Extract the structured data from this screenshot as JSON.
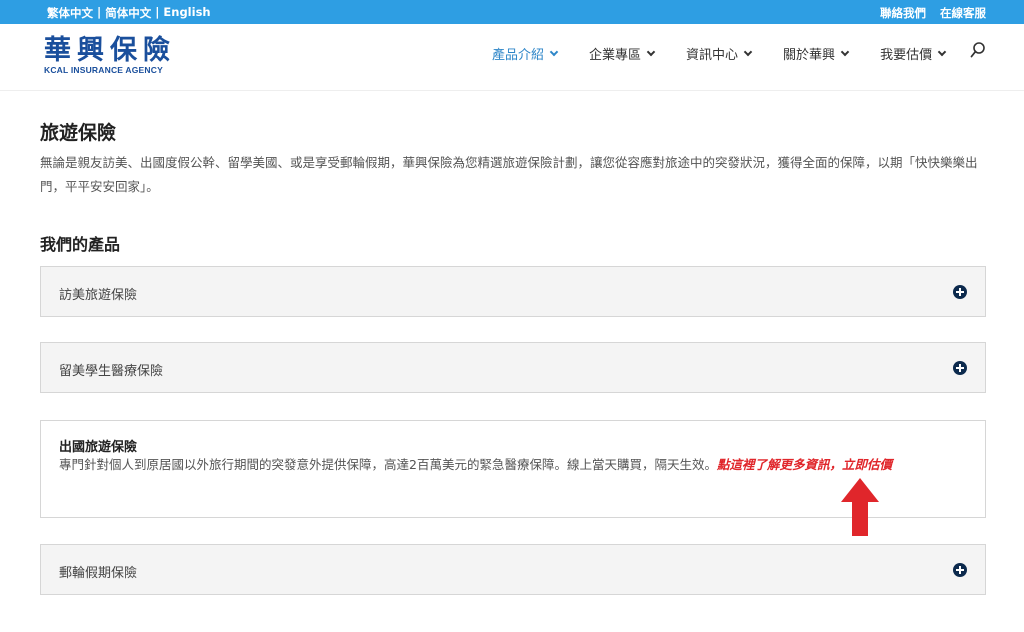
{
  "topbar": {
    "lang_trad": "繁体中文",
    "lang_simp": "简体中文",
    "lang_en": "English",
    "separator": "|",
    "contact": "聯絡我們",
    "online_service": "在線客服"
  },
  "logo": {
    "cn": "華興保險",
    "en": "KCAL INSURANCE AGENCY"
  },
  "nav": {
    "items": [
      {
        "label": "產品介紹"
      },
      {
        "label": "企業專區"
      },
      {
        "label": "資訊中心"
      },
      {
        "label": "關於華興"
      },
      {
        "label": "我要估價"
      }
    ]
  },
  "main": {
    "title": "旅遊保險",
    "intro": "無論是親友訪美、出國度假公幹、留學美國、或是享受郵輪假期，華興保險為您精選旅遊保險計劃，讓您從容應對旅途中的突發狀況，獲得全面的保障，以期「快快樂樂出門，平平安安回家」。",
    "section_title": "我們的產品"
  },
  "products": {
    "p1": "訪美旅遊保險",
    "p2": "留美學生醫療保險",
    "p3_title": "出國旅遊保險",
    "p3_body": "專門針對個人到原居國以外旅行期間的突發意外提供保障，高達2百萬美元的緊急醫療保障。線上當天購買，隔天生效。",
    "p3_cta": "點這裡了解更多資訊，立即估價",
    "p4": "郵輪假期保險"
  },
  "colors": {
    "topbar": "#2e9ee3",
    "brand": "#1a4f9c",
    "active_nav": "#2e86c8",
    "cta": "#e0262b",
    "plus_icon": "#0c2a4d",
    "arrow": "#e0262b"
  }
}
